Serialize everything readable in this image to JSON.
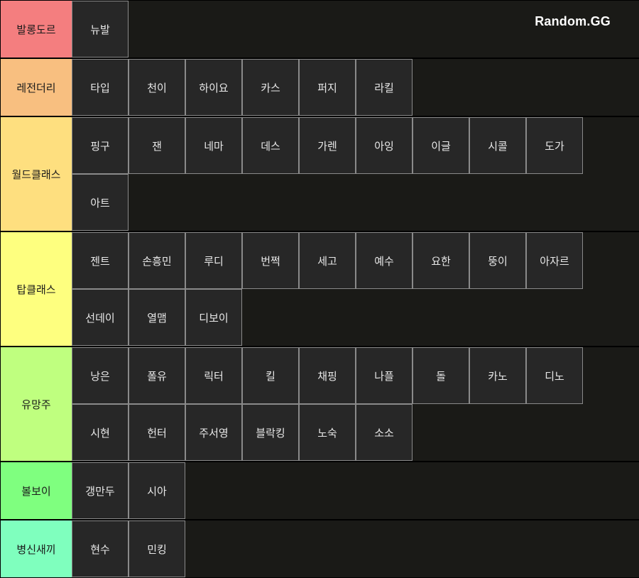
{
  "brand": "Random.GG",
  "tiers": [
    {
      "label": "발롱도르",
      "color": "#f47e7f",
      "items": [
        "뉴발"
      ]
    },
    {
      "label": "레전더리",
      "color": "#f8bf80",
      "items": [
        "타입",
        "천이",
        "하이요",
        "카스",
        "퍼지",
        "라킬"
      ]
    },
    {
      "label": "월드클래스",
      "color": "#fedf7f",
      "items": [
        "핑구",
        "잰",
        "네마",
        "데스",
        "가렌",
        "아잉",
        "이글",
        "시콜",
        "도가",
        "아트"
      ]
    },
    {
      "label": "탑클래스",
      "color": "#feff7f",
      "items": [
        "젠트",
        "손흥민",
        "루디",
        "번쩍",
        "세고",
        "예수",
        "요한",
        "뚱이",
        "아자르",
        "선데이",
        "열맴",
        "디보이"
      ]
    },
    {
      "label": "유망주",
      "color": "#bfff7f",
      "items": [
        "낭은",
        "폴유",
        "릭터",
        "킬",
        "채핑",
        "나플",
        "돌",
        "카노",
        "디노",
        "시현",
        "헌터",
        "주서영",
        "블락킹",
        "노숙",
        "소소"
      ]
    },
    {
      "label": "볼보이",
      "color": "#7fff7f",
      "items": [
        "갱만두",
        "시아"
      ]
    },
    {
      "label": "병신새끼",
      "color": "#7fffbe",
      "items": [
        "현수",
        "민킹"
      ]
    }
  ]
}
